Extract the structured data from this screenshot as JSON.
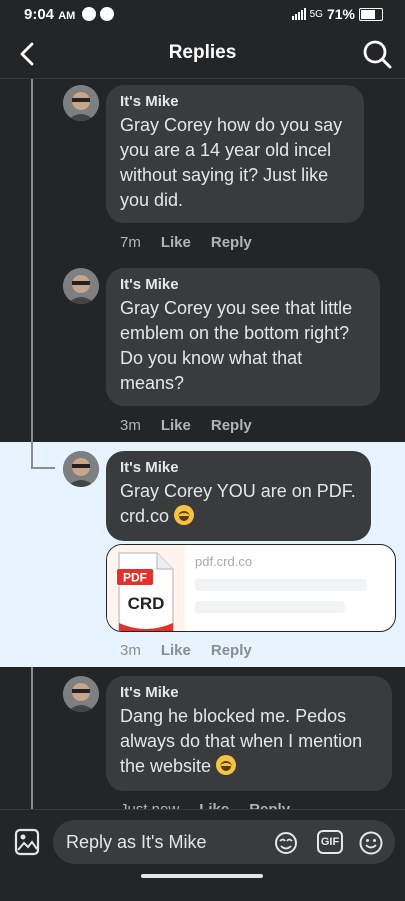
{
  "status_bar": {
    "time": "9:04",
    "ampm": "AM",
    "network": "5G",
    "battery": "71%"
  },
  "header": {
    "title": "Replies"
  },
  "comments": [
    {
      "author": "It's Mike",
      "text": "Gray Corey how do you say you are a 14 year old incel without saying it?  Just like you did.",
      "time": "7m",
      "like": "Like",
      "reply": "Reply"
    },
    {
      "author": "It's Mike",
      "text": "Gray Corey you see that little emblem on the bottom right? Do you know what that means?",
      "time": "3m",
      "like": "Like",
      "reply": "Reply"
    },
    {
      "author": "It's Mike",
      "text": "Gray Corey YOU are on PDF. crd.co",
      "time": "3m",
      "like": "Like",
      "reply": "Reply",
      "link_preview": {
        "domain": "pdf.crd.co",
        "thumb_top": "PDF",
        "thumb_bottom": "CRD"
      }
    },
    {
      "author": "It's Mike",
      "text": "Dang he blocked me.  Pedos always do that when I mention the website",
      "time": "Just now",
      "like": "Like",
      "reply": "Reply"
    }
  ],
  "composer": {
    "placeholder": "Reply as It's Mike",
    "gif_label": "GIF"
  },
  "colors": {
    "background": "#242526",
    "bubble": "#3a3b3c",
    "highlight": "#e7f3ff",
    "text": "#e4e6eb",
    "meta": "#b0b3b8",
    "pdf_red": "#e2312d"
  },
  "icons": [
    "back-arrow-icon",
    "search-icon",
    "photo-icon",
    "sticker-icon",
    "gif-icon",
    "emoji-icon"
  ]
}
